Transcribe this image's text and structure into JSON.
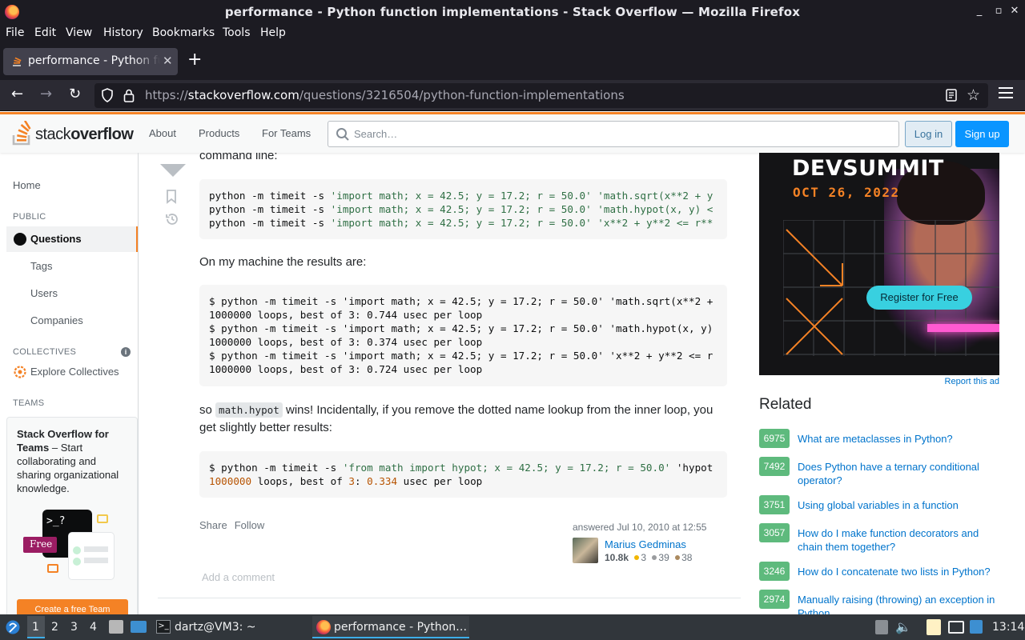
{
  "window": {
    "title": "performance - Python function implementations - Stack Overflow — Mozilla Firefox",
    "controls": [
      "_",
      "▫",
      "✕"
    ]
  },
  "menu": [
    "File",
    "Edit",
    "View",
    "History",
    "Bookmarks",
    "Tools",
    "Help"
  ],
  "tab": {
    "title": "performance - Python function implementations - Stack Overflow",
    "close": "✕",
    "new_tab": "+"
  },
  "url": {
    "scheme": "https://",
    "host": "stackoverflow.com",
    "path": "/questions/3216504/python-function-implementations"
  },
  "so_header": {
    "logo_light": "stack",
    "logo_bold": "overflow",
    "nav": [
      "About",
      "Products",
      "For Teams"
    ],
    "search_placeholder": "Search…",
    "login": "Log in",
    "signup": "Sign up"
  },
  "sidebar": {
    "home": "Home",
    "public_head": "PUBLIC",
    "questions": "Questions",
    "tags": "Tags",
    "users": "Users",
    "companies": "Companies",
    "collectives_head": "COLLECTIVES",
    "info": "i",
    "explore": "Explore Collectives",
    "teams_head": "TEAMS",
    "teams_title": "Stack Overflow for Teams",
    "teams_body": " – Start collaborating and sharing organizational knowledge.",
    "illus_prompt": ">_?",
    "free_badge": "Free",
    "create_team": "Create a free Team"
  },
  "post": {
    "p_command_line": "command line:",
    "code1": [
      [
        "python -m timeit -s ",
        "'import math; x = 42.5; y = 17.2; r = 50.0'",
        " ",
        "'math.sqrt(x**2 + y"
      ],
      [
        "python -m timeit -s ",
        "'import math; x = 42.5; y = 17.2; r = 50.0'",
        " ",
        "'math.hypot(x, y) <"
      ],
      [
        "python -m timeit -s ",
        "'import math; x = 42.5; y = 17.2; r = 50.0'",
        " ",
        "'x**2 + y**2 <= r**"
      ]
    ],
    "p_results": "On my machine the results are:",
    "code2": [
      "$ python -m timeit -s 'import math; x = 42.5; y = 17.2; r = 50.0' 'math.sqrt(x**2 +",
      "1000000 loops, best of 3: 0.744 usec per loop",
      "$ python -m timeit -s 'import math; x = 42.5; y = 17.2; r = 50.0' 'math.hypot(x, y)",
      "1000000 loops, best of 3: 0.374 usec per loop",
      "$ python -m timeit -s 'import math; x = 42.5; y = 17.2; r = 50.0' 'x**2 + y**2 <= r",
      "1000000 loops, best of 3: 0.724 usec per loop"
    ],
    "p3_prefix": "so ",
    "p3_code": "math.hypot",
    "p3_suffix": " wins! Incidentally, if you remove the dotted name lookup from the inner loop, you get slightly better results:",
    "code3_line1_a": "$ python -m timeit -s ",
    "code3_line1_b": "'from math import hypot; x = 42.5; y = 17.2; r = 50.0'",
    "code3_line1_c": " 'hypot",
    "code3_line2": {
      "n1": "1000000",
      "t1": " loops, best of ",
      "n2": "3",
      "t2": ": ",
      "n3": "0.334",
      "t3": " usec per loop"
    },
    "share": "Share",
    "follow": "Follow",
    "answered": "answered Jul 10, 2010 at 12:55",
    "user": "Marius Gedminas",
    "rep": "10.8k",
    "gold": "3",
    "silver": "39",
    "bronze": "38",
    "add_comment": "Add a comment"
  },
  "ad": {
    "title": "DEVSUMMIT",
    "date": "OCT 26, 2022",
    "cta": "Register for Free",
    "report": "Report this ad"
  },
  "related": {
    "title": "Related",
    "items": [
      {
        "count": "6975",
        "q": "What are metaclasses in Python?"
      },
      {
        "count": "7492",
        "q": "Does Python have a ternary conditional operator?"
      },
      {
        "count": "3751",
        "q": "Using global variables in a function"
      },
      {
        "count": "3057",
        "q": "How do I make function decorators and chain them together?"
      },
      {
        "count": "3246",
        "q": "How do I concatenate two lists in Python?"
      },
      {
        "count": "2974",
        "q": "Manually raising (throwing) an exception in Python"
      }
    ]
  },
  "taskbar": {
    "workspaces": [
      "1",
      "2",
      "3",
      "4"
    ],
    "terminal": "dartz@VM3: ~",
    "firefox": "performance - Python…",
    "clock": "13:14"
  },
  "colors": {
    "so_orange": "#f48225",
    "so_blue": "#0a95ff",
    "answered_green": "#5eba7d",
    "firefox_dark": "#1c1b22"
  }
}
